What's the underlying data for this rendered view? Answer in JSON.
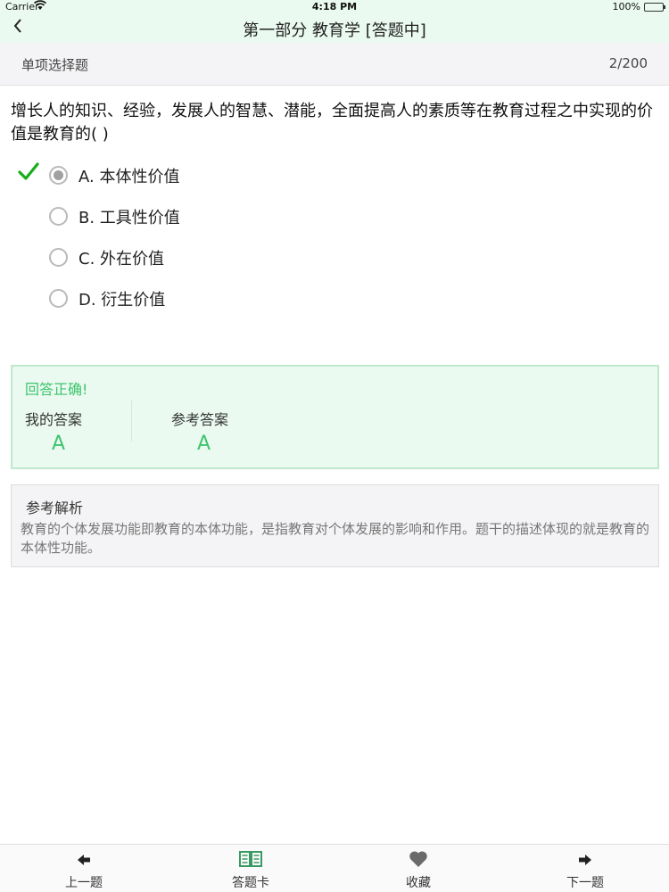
{
  "status_bar": {
    "carrier": "Carrier",
    "time": "4:18 PM",
    "battery": "100%"
  },
  "nav": {
    "back_icon": "chevron-left-icon",
    "title": "第一部分 教育学 [答题中]"
  },
  "section": {
    "question_type": "单项选择题",
    "progress": "2/200"
  },
  "question": {
    "text": "增长人的知识、经验，发展人的智慧、潜能，全面提高人的素质等在教育过程之中实现的价值是教育的(    )",
    "options": [
      {
        "label": "A. 本体性价值",
        "selected": true,
        "correct": true
      },
      {
        "label": "B. 工具性价值",
        "selected": false,
        "correct": false
      },
      {
        "label": "C. 外在价值",
        "selected": false,
        "correct": false
      },
      {
        "label": "D. 衍生价值",
        "selected": false,
        "correct": false
      }
    ]
  },
  "result": {
    "status": "回答正确!",
    "my_answer_label": "我的答案",
    "my_answer": "A",
    "reference_label": "参考答案",
    "reference_answer": "A"
  },
  "explanation": {
    "title": "参考解析",
    "text": "教育的个体发展功能即教育的本体功能，是指教育对个体发展的影响和作用。题干的描述体现的就是教育的本体性功能。"
  },
  "tabs": [
    {
      "label": "上一题",
      "icon": "arrow-left-icon"
    },
    {
      "label": "答题卡",
      "icon": "book-icon"
    },
    {
      "label": "收藏",
      "icon": "heart-icon"
    },
    {
      "label": "下一题",
      "icon": "arrow-right-icon"
    }
  ],
  "colors": {
    "accent_green": "#3ec46d",
    "check_green": "#1aad19",
    "header_bg": "#eafaf0"
  }
}
